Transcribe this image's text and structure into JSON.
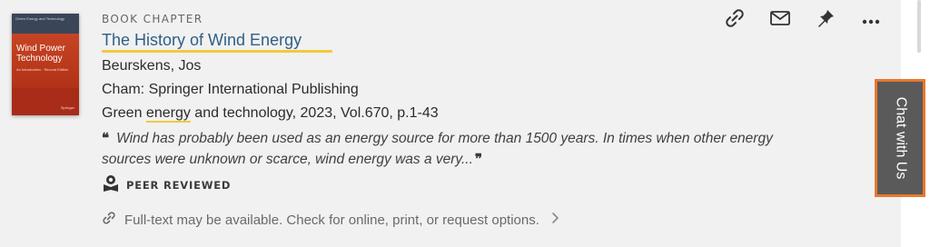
{
  "record": {
    "type_label": "BOOK CHAPTER",
    "title": "The History of Wind Energy",
    "author": "Beurskens, Jos",
    "publisher": "Cham: Springer International Publishing",
    "source_prefix": "Green ",
    "source_highlight": "energy",
    "source_suffix": " and technology, 2023, Vol.670, p.1-43",
    "snippet": "Wind has probably been used as an energy source for more than 1500 years. In times when other energy sources were unknown or scarce, wind energy was a very...",
    "peer_label": "PEER REVIEWED",
    "fulltext": "Full-text may be available. Check for online, print, or request options."
  },
  "cover": {
    "title": "Wind Power Technology",
    "subtitle": "An Introduction · Second Edition",
    "top_text": "Green Energy and Technology",
    "publisher_logo": "Springer"
  },
  "actions": [
    {
      "name": "link",
      "icon": "link-icon"
    },
    {
      "name": "email",
      "icon": "email-icon"
    },
    {
      "name": "pin",
      "icon": "pin-icon"
    },
    {
      "name": "more",
      "icon": "more-icon"
    }
  ],
  "chat": {
    "label": "Chat with Us",
    "border_color": "#e8792e",
    "bg_color": "#5a5a5a"
  },
  "colors": {
    "title": "#2f5f86",
    "highlight": "#f3c93e",
    "cover_red": "#b8321c"
  }
}
